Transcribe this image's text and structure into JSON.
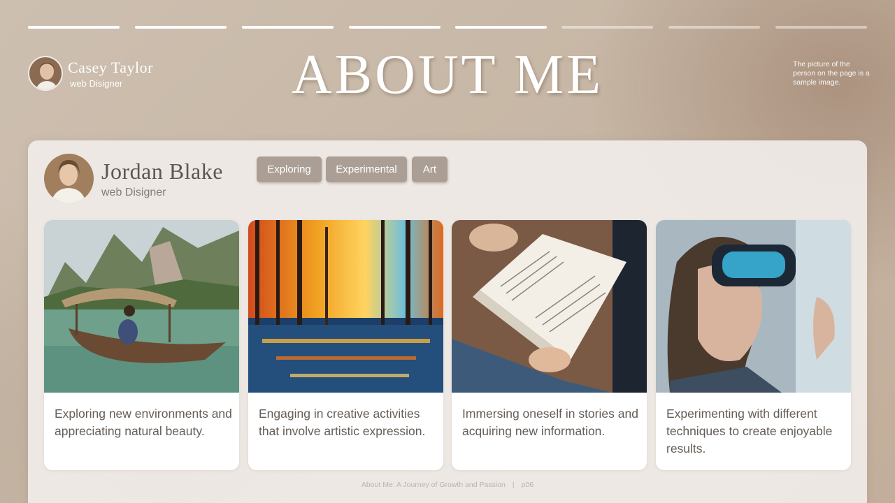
{
  "progress": {
    "total_segments": 8,
    "completed_segments": 5
  },
  "header": {
    "author_name": "Casey Taylor",
    "author_role": "web Disigner",
    "title": "ABOUT ME",
    "note": "The picture of the person on the page is a sample image."
  },
  "profile": {
    "name": "Jordan Blake",
    "role": "web Disigner",
    "tags": [
      "Exploring",
      "Experimental",
      "Art"
    ]
  },
  "cards": [
    {
      "image": "boat-on-lake-photo",
      "text": "Exploring new environments and appreciating natural beauty."
    },
    {
      "image": "autumn-forest-painting",
      "text": "Engaging in creative activities that involve artistic expression."
    },
    {
      "image": "open-book-reading-photo",
      "text": "Immersing oneself in stories and acquiring new information."
    },
    {
      "image": "vr-headset-person-photo",
      "text": "Experimenting with different techniques to create enjoyable results."
    }
  ],
  "footer": {
    "caption": "About Me: A Journey of Growth and Passion",
    "separator": "|",
    "page": "p06"
  },
  "colors": {
    "tag_bg": "#ab9f95",
    "panel_bg": "#f0ece8",
    "text": "#655d57"
  }
}
